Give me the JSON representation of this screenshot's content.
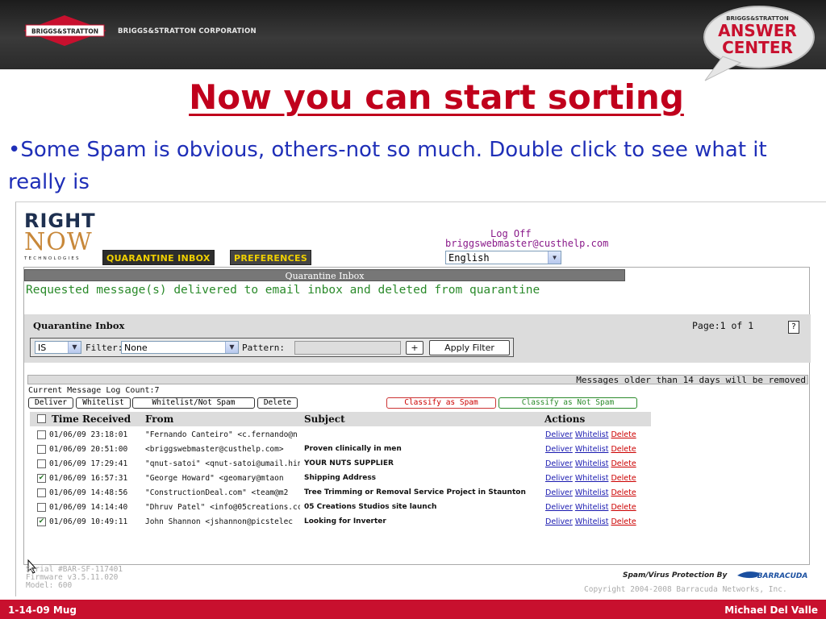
{
  "slide": {
    "header": {
      "logo_text": "BRIGGS&STRATTON",
      "corporation": "BRIGGS&STRATTON CORPORATION",
      "answer_center_top": "BRIGGS&STRATTON",
      "answer_center_line1": "ANSWER",
      "answer_center_line2": "CENTER"
    },
    "title": "Now you can start sorting",
    "bullet": "•Some Spam is obvious, others-not so much. Double click to see what it really is",
    "footer_left": "1-14-09 Mug",
    "footer_right": "Michael Del Valle"
  },
  "app": {
    "logo": {
      "line1": "RIGHT",
      "line2": "NOW",
      "line3": "TECHNOLOGIES"
    },
    "tabs": [
      "QUARANTINE INBOX",
      "PREFERENCES"
    ],
    "active_tab": "QUARANTINE INBOX",
    "logoff": "Log Off",
    "user_email": "briggswebmaster@custhelp.com",
    "language": "English",
    "section_bar": "Quarantine Inbox",
    "status_message": "Requested message(s) delivered to email inbox and deleted from quarantine",
    "panel_title": "Quarantine Inbox",
    "page_info": "Page:1 of 1",
    "help": "?",
    "filter": {
      "operator": "IS",
      "filter_label": "Filter:",
      "filter_value": "None",
      "pattern_label": "Pattern:",
      "pattern_value": "",
      "plus_label": "+",
      "apply_label": "Apply Filter"
    },
    "older_notice": "Messages older than 14 days will be removed",
    "log_count": "Current Message Log Count:7",
    "action_buttons": {
      "deliver": "Deliver",
      "whitelist": "Whitelist",
      "whitelist_not_spam": "Whitelist/Not Spam",
      "delete": "Delete",
      "classify_spam": "Classify as Spam",
      "classify_not_spam": "Classify as Not Spam"
    },
    "columns": [
      "Time Received",
      "From",
      "Subject",
      "Actions"
    ],
    "row_actions": {
      "deliver": "Deliver",
      "whitelist": "Whitelist",
      "delete": "Delete"
    },
    "messages": [
      {
        "time": "01/06/09 23:18:01",
        "from": "\"Fernando Canteiro\" <c.fernando@n",
        "subject": "",
        "checked": false
      },
      {
        "time": "01/06/09 20:51:00",
        "from": "<briggswebmaster@custhelp.com>",
        "subject": "Proven clinically in men",
        "checked": false
      },
      {
        "time": "01/06/09 17:29:41",
        "from": "\"qnut-satoi\" <qnut-satoi@umail.hin",
        "subject": "YOUR NUTS SUPPLIER",
        "checked": false
      },
      {
        "time": "01/06/09 16:57:31",
        "from": "\"George Howard\" <geomary@mtaon",
        "subject": "Shipping Address",
        "checked": true
      },
      {
        "time": "01/06/09 14:48:56",
        "from": "\"ConstructionDeal.com\" <team@m2",
        "subject": "Tree Trimming or Removal Service Project in Staunton",
        "checked": false
      },
      {
        "time": "01/06/09 14:14:40",
        "from": "\"Dhruv Patel\" <info@05creations.cc",
        "subject": "05 Creations Studios site launch",
        "checked": false
      },
      {
        "time": "01/06/09 10:49:11",
        "from": "John Shannon <jshannon@picstelec",
        "subject": "Looking for Inverter",
        "checked": true
      }
    ],
    "footer": {
      "serial": "Serial #BAR-SF-117401",
      "firmware": "Firmware v3.5.11.020",
      "model": "Model: 600",
      "protection": "Spam/Virus Protection By",
      "barracuda": "BARRACUDA",
      "copyright": "Copyright 2004-2008 Barracuda Networks, Inc."
    }
  },
  "colors": {
    "title_red": "#c0001c",
    "bullet_blue": "#1f2fb8",
    "footer_red": "#c8102e",
    "status_green": "#2a8a2a",
    "tab_yellow": "#f0d000"
  }
}
